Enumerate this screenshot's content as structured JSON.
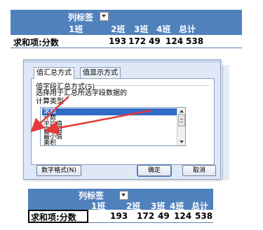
{
  "colors": {
    "header_bg": "#4f81bd",
    "header_text": "#ffffff",
    "arrow_red": "#e53a3a",
    "selection": "#3169c6"
  },
  "pivot_top": {
    "col_label": "列标签",
    "columns": [
      "1班",
      "2班",
      "3班",
      "4班",
      "总计"
    ],
    "row_label": "求和项:分数",
    "values": [
      "193",
      "172",
      "49",
      "124",
      "538"
    ]
  },
  "dialog": {
    "tabs": [
      "值汇总方式",
      "值显示方式"
    ],
    "group_title": "值字段汇总方式(S)",
    "description": [
      "选择用于汇总所选字段数据的",
      "计算类型"
    ],
    "list_items": [
      "求和",
      "计数",
      "平均值",
      "最大值",
      "最小值",
      "乘积"
    ],
    "selected_index": 0,
    "buttons": {
      "number_format": "数字格式(N)",
      "ok": "确定",
      "cancel": "取消"
    }
  },
  "pivot_bottom": {
    "col_label": "列标签",
    "columns": [
      "1班",
      "2班",
      "3班",
      "4班",
      "总计"
    ],
    "row_label": "求和项:分数",
    "values": [
      "193",
      "172",
      "49",
      "124",
      "538"
    ]
  }
}
